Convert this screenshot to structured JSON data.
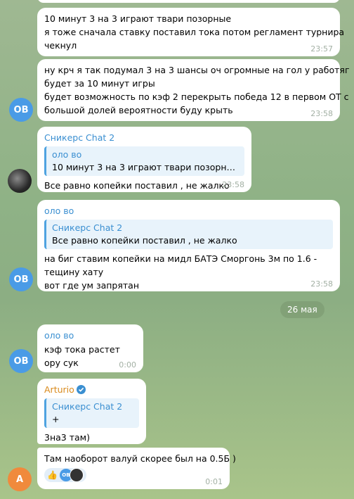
{
  "messages": {
    "m1": {
      "lines": [
        "10 минут 3 на 3 играют твари позорные",
        "я тоже сначала ставку поставил тока потом регламент турнира",
        "чекнул"
      ],
      "time": "23:57"
    },
    "m2": {
      "lines": [
        "ну крч я так подумал 3 на 3 шансы оч огромные на гол у работяг",
        "будет за 10 минут игры",
        "будет возможность по кэф 2 перекрыть победа 12 в первом ОТ с",
        "большой долей вероятности буду крыть"
      ],
      "time": "23:58",
      "avatar": "ОВ"
    },
    "m3": {
      "sender": "Сникерс Chat 2",
      "reply_name": "оло во",
      "reply_text": "10 минут 3 на 3 играют твари позорные я...",
      "lines": [
        "Все равно копейки поставил , не жалко"
      ],
      "time": "23:58"
    },
    "m4": {
      "sender": "оло во",
      "reply_name": "Сникерс Chat 2",
      "reply_text": "Все равно копейки поставил , не жалко",
      "lines": [
        "на биг ставим копейки на мидл БАТЭ Сморгонь 3м по 1.6 -",
        "тещину хату",
        "вот где ум запрятан"
      ],
      "time": "23:58",
      "avatar": "ОВ"
    },
    "date_divider": "26 мая",
    "m5": {
      "sender": "оло во",
      "lines": [
        "кэф тока растет",
        "ору сук"
      ],
      "time": "0:00",
      "avatar": "ОВ"
    },
    "m6": {
      "sender": "Arturio",
      "reply_name": "Сникерс Chat 2",
      "reply_text": "+",
      "lines": [
        "3на3 там)"
      ]
    },
    "m7": {
      "lines": [
        "Там наоборот валуй скорее был на 0.5Б )"
      ],
      "time": "0:01",
      "avatar": "А",
      "reaction_emoji": "👍",
      "reaction_avatar": "ОВ"
    }
  },
  "colors": {
    "accent": "#3a8fd1",
    "avatar_ob": "#4a9be6",
    "avatar_a": "#f08a3c"
  }
}
